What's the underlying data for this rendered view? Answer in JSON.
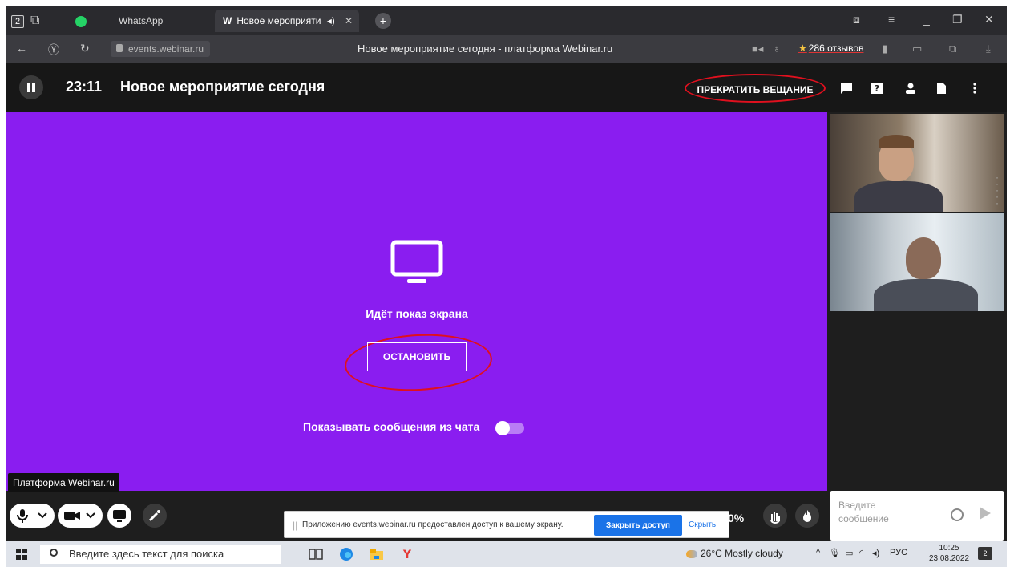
{
  "browser": {
    "tab_count": "2",
    "tabs": [
      {
        "label": "WhatsApp"
      },
      {
        "label": "Новое мероприяти",
        "prefix": "W"
      }
    ],
    "address": "events.webinar.ru",
    "page_title": "Новое мероприятие сегодня - платформа Webinar.ru",
    "reviews": "286 отзывов"
  },
  "header": {
    "timer": "23:11",
    "event_title": "Новое мероприятие сегодня",
    "stop_broadcast_label": "ПРЕКРАТИТЬ ВЕЩАНИЕ"
  },
  "stage": {
    "status_text": "Идёт показ экрана",
    "stop_button_label": "ОСТАНОВИТЬ",
    "show_chat_label": "Показывать сообщения из чата",
    "show_chat_enabled": false,
    "color": "#8a1df0"
  },
  "controls": {
    "tooltip": "Платформа Webinar.ru",
    "percent": "0%"
  },
  "share_notice": {
    "message": "Приложению events.webinar.ru предоставлен доступ к вашему экрану.",
    "close_access_label": "Закрыть доступ",
    "hide_label": "Скрыть"
  },
  "chat": {
    "placeholder": "Введите сообщение"
  },
  "taskbar": {
    "search_placeholder": "Введите здесь текст для поиска",
    "weather": "26°C Mostly cloudy",
    "language": "РУС",
    "time": "10:25",
    "date": "23.08.2022",
    "notification_count": "2"
  },
  "colors": {
    "accent_red": "#e0101e",
    "link_blue": "#1a73e8"
  }
}
